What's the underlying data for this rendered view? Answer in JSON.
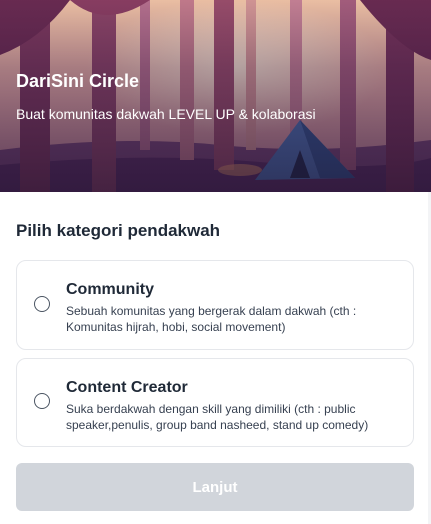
{
  "hero": {
    "title": "DariSini Circle",
    "subtitle": "Buat komunitas dakwah LEVEL UP & kolaborasi"
  },
  "section": {
    "title": "Pilih kategori pendakwah"
  },
  "options": [
    {
      "title": "Community",
      "description": "Sebuah komunitas yang bergerak dalam dakwah (cth : Komunitas hijrah, hobi, social movement)",
      "selected": false
    },
    {
      "title": "Content Creator",
      "description": "Suka berdakwah dengan skill yang dimiliki (cth : public speaker,penulis, group band nasheed, stand up comedy)",
      "selected": false
    }
  ],
  "button": {
    "label": "Lanjut",
    "disabled": true
  },
  "colors": {
    "button_disabled": "#d1d5db",
    "card_border": "#e5e7eb",
    "hero_overlay": "#3b1d4a"
  }
}
